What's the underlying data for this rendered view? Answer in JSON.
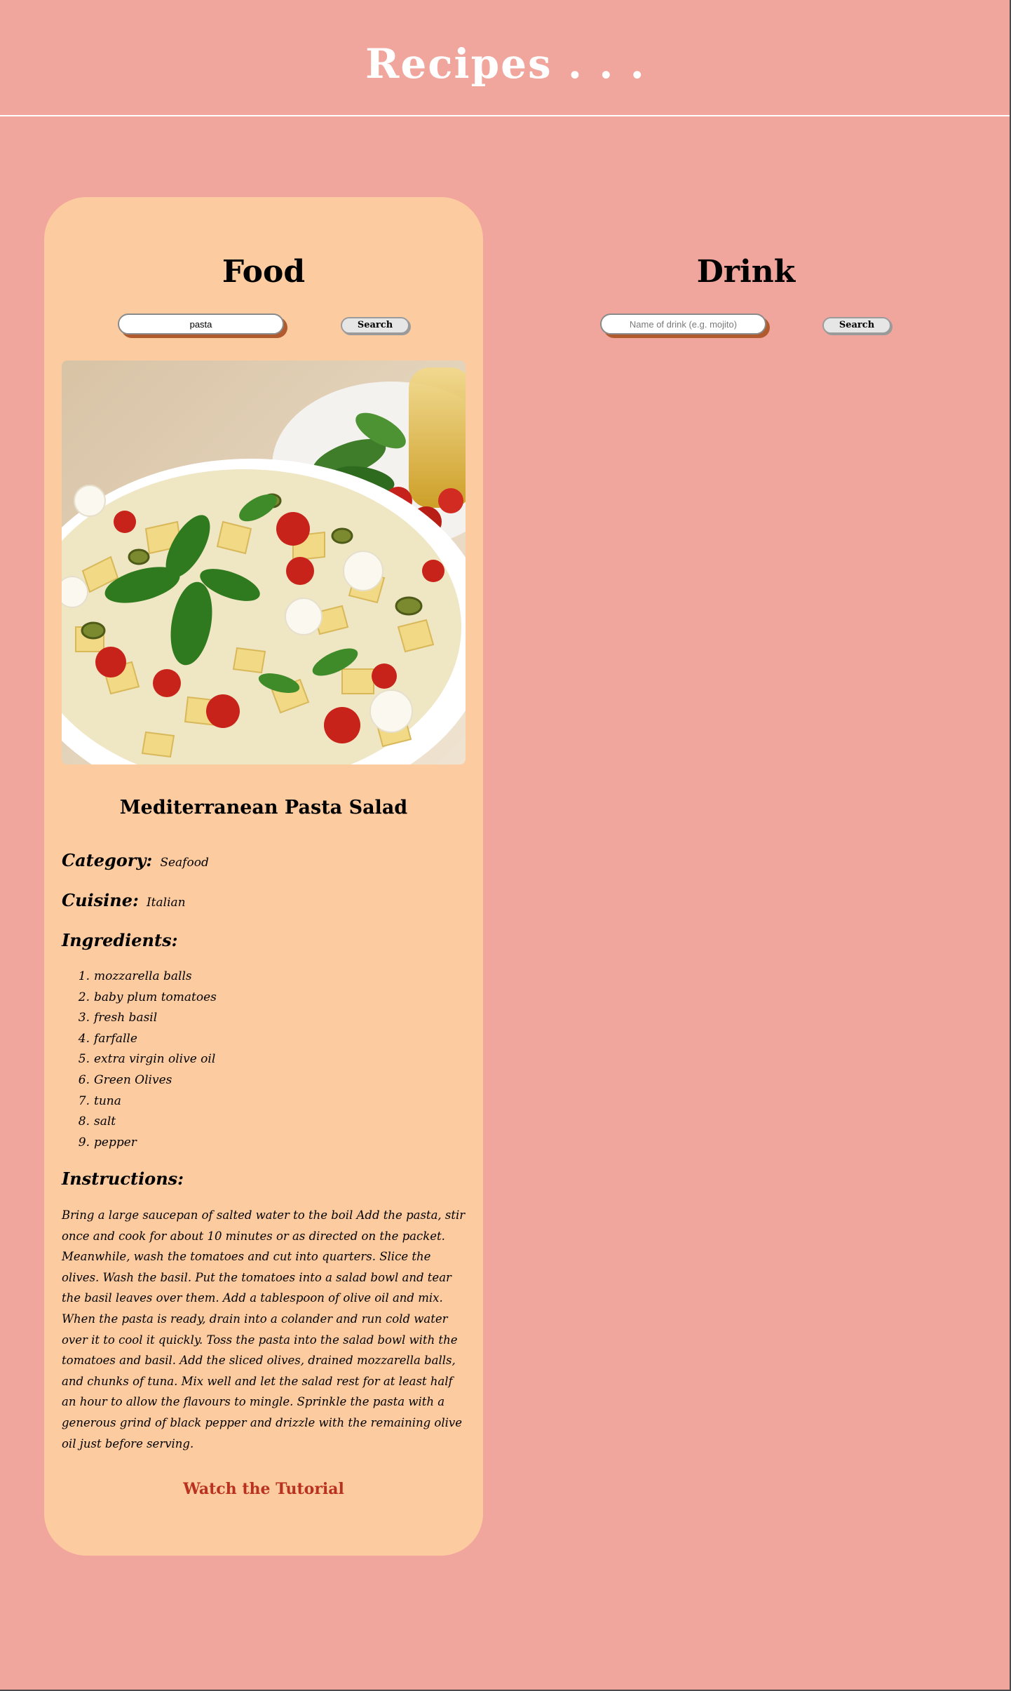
{
  "header": {
    "title": "Recipes . . ."
  },
  "food": {
    "heading": "Food",
    "search": {
      "value": "pasta",
      "placeholder": "",
      "button_label": "Search"
    },
    "recipe": {
      "image_icon": "pasta-salad-photo",
      "title": "Mediterranean Pasta Salad",
      "category_label": "Category:",
      "category_value": "Seafood",
      "cuisine_label": "Cuisine:",
      "cuisine_value": "Italian",
      "ingredients_label": "Ingredients:",
      "ingredients": [
        "mozzarella balls",
        "baby plum tomatoes",
        "fresh basil",
        "farfalle",
        "extra virgin olive oil",
        "Green Olives",
        "tuna",
        "salt",
        "pepper"
      ],
      "instructions_label": "Instructions:",
      "instructions": "Bring a large saucepan of salted water to the boil Add the pasta, stir once and cook for about 10 minutes or as directed on the packet. Meanwhile, wash the tomatoes and cut into quarters. Slice the olives. Wash the basil. Put the tomatoes into a salad bowl and tear the basil leaves over them. Add a tablespoon of olive oil and mix. When the pasta is ready, drain into a colander and run cold water over it to cool it quickly. Toss the pasta into the salad bowl with the tomatoes and basil. Add the sliced olives, drained mozzarella balls, and chunks of tuna. Mix well and let the salad rest for at least half an hour to allow the flavours to mingle. Sprinkle the pasta with a generous grind of black pepper and drizzle with the remaining olive oil just before serving.",
      "tutorial_link": "Watch the Tutorial"
    }
  },
  "drink": {
    "heading": "Drink",
    "search": {
      "value": "",
      "placeholder": "Name of drink (e.g. mojito)",
      "button_label": "Search"
    }
  },
  "colors": {
    "background": "#f0a69d",
    "card": "#fdcba0",
    "link": "#b8321f",
    "input_shadow": "#b15a2e"
  }
}
